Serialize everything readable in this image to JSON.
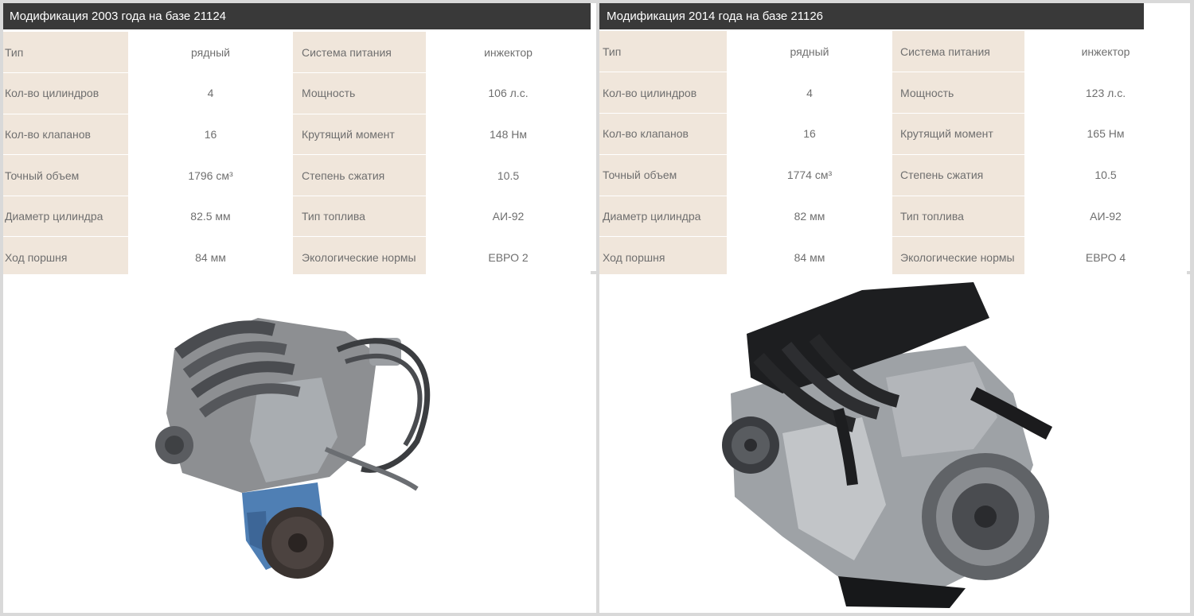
{
  "left": {
    "title": "Модификация 2003 года на базе 21124",
    "rows": [
      {
        "k1": "Тип",
        "v1": "рядный",
        "k2": "Система питания",
        "v2": "инжектор"
      },
      {
        "k1": "Кол-во цилиндров",
        "v1": "4",
        "k2": "Мощность",
        "v2": "106 л.с."
      },
      {
        "k1": "Кол-во клапанов",
        "v1": "16",
        "k2": "Крутящий момент",
        "v2": "148 Нм"
      },
      {
        "k1": "Точный объем",
        "v1": "1796 см³",
        "k2": "Степень сжатия",
        "v2": "10.5"
      },
      {
        "k1": "Диаметр цилиндра",
        "v1": "82.5 мм",
        "k2": "Тип топлива",
        "v2": "АИ-92"
      },
      {
        "k1": "Ход поршня",
        "v1": "84 мм",
        "k2": "Экологические нормы",
        "v2": "ЕВРО 2"
      }
    ]
  },
  "right": {
    "title": "Модификация 2014 года на базе 21126",
    "rows": [
      {
        "k1": "Тип",
        "v1": "рядный",
        "k2": "Система питания",
        "v2": "инжектор"
      },
      {
        "k1": "Кол-во цилиндров",
        "v1": "4",
        "k2": "Мощность",
        "v2": "123 л.с."
      },
      {
        "k1": "Кол-во клапанов",
        "v1": "16",
        "k2": "Крутящий момент",
        "v2": "165 Нм"
      },
      {
        "k1": "Точный объем",
        "v1": "1774 см³",
        "k2": "Степень сжатия",
        "v2": "10.5"
      },
      {
        "k1": "Диаметр цилиндра",
        "v1": "82 мм",
        "k2": "Тип топлива",
        "v2": "АИ-92"
      },
      {
        "k1": "Ход поршня",
        "v1": "84 мм",
        "k2": "Экологические нормы",
        "v2": "ЕВРО 4"
      }
    ]
  },
  "colors": {
    "title_bar": "#393939",
    "key_cell": "#f0e6db",
    "page_bg": "#d9d9d9",
    "engine_block_blue": "#4f7fb4"
  },
  "images": {
    "left_icon": "engine-21124-photo",
    "right_icon": "engine-21126-photo"
  }
}
